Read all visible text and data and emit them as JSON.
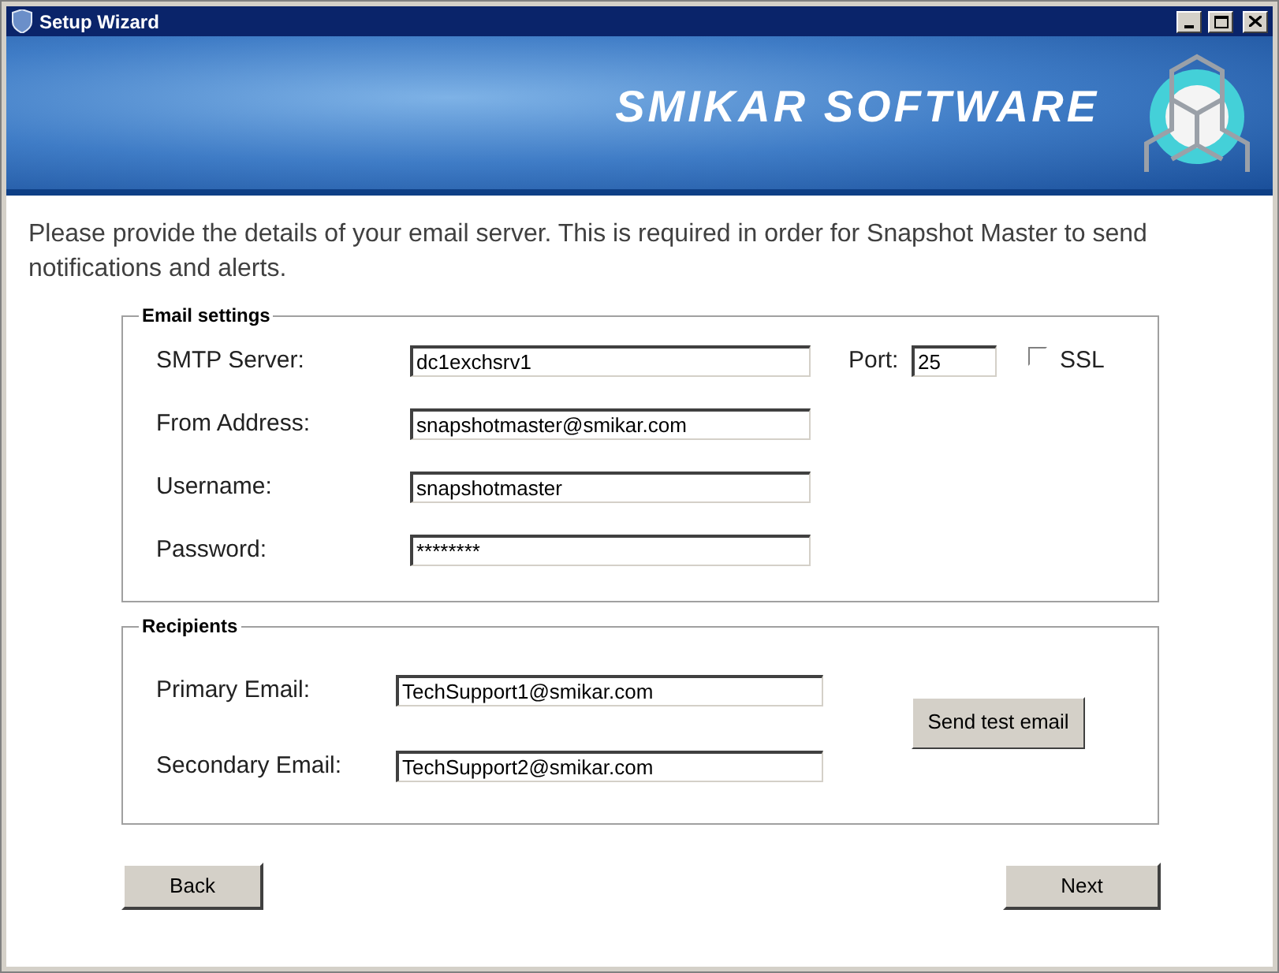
{
  "window": {
    "title": "Setup Wizard"
  },
  "banner": {
    "brand": "SMIKAR SOFTWARE"
  },
  "intro": "Please provide the details of your email server. This is required in order for Snapshot Master to send notifications and alerts.",
  "email_settings": {
    "legend": "Email settings",
    "fields": [
      {
        "label": "SMTP Server:",
        "value": "dc1exchsrv1"
      },
      {
        "label": "From Address:",
        "value": "snapshotmaster@smikar.com"
      },
      {
        "label": "Username:",
        "value": "snapshotmaster"
      },
      {
        "label": "Password:",
        "value": "********"
      }
    ],
    "port": {
      "label": "Port:",
      "value": "25"
    },
    "ssl": {
      "label": "SSL",
      "checked": false
    }
  },
  "recipients": {
    "legend": "Recipients",
    "fields": [
      {
        "label": "Primary Email:",
        "value": "TechSupport1@smikar.com"
      },
      {
        "label": "Secondary Email:",
        "value": "TechSupport2@smikar.com"
      }
    ],
    "test_button": "Send test email"
  },
  "buttons": {
    "back": "Back",
    "next": "Next"
  }
}
